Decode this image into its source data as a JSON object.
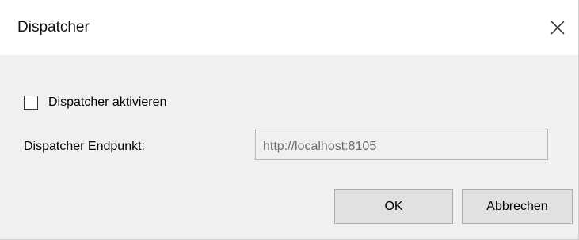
{
  "window": {
    "title": "Dispatcher",
    "close_icon": "close-icon"
  },
  "form": {
    "enable_checkbox": {
      "label": "Dispatcher aktivieren",
      "checked": false
    },
    "endpoint": {
      "label": "Dispatcher Endpunkt:",
      "value": "http://localhost:8105",
      "disabled": true
    }
  },
  "buttons": {
    "ok_label": "OK",
    "cancel_label": "Abbrechen"
  }
}
